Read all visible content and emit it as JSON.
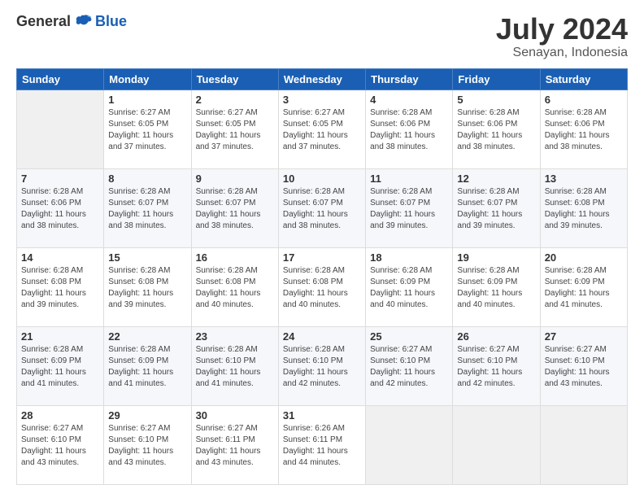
{
  "logo": {
    "general": "General",
    "blue": "Blue"
  },
  "title": {
    "month": "July 2024",
    "location": "Senayan, Indonesia"
  },
  "headers": [
    "Sunday",
    "Monday",
    "Tuesday",
    "Wednesday",
    "Thursday",
    "Friday",
    "Saturday"
  ],
  "weeks": [
    {
      "days": [
        {
          "num": "",
          "info": ""
        },
        {
          "num": "1",
          "info": "Sunrise: 6:27 AM\nSunset: 6:05 PM\nDaylight: 11 hours\nand 37 minutes."
        },
        {
          "num": "2",
          "info": "Sunrise: 6:27 AM\nSunset: 6:05 PM\nDaylight: 11 hours\nand 37 minutes."
        },
        {
          "num": "3",
          "info": "Sunrise: 6:27 AM\nSunset: 6:05 PM\nDaylight: 11 hours\nand 37 minutes."
        },
        {
          "num": "4",
          "info": "Sunrise: 6:28 AM\nSunset: 6:06 PM\nDaylight: 11 hours\nand 38 minutes."
        },
        {
          "num": "5",
          "info": "Sunrise: 6:28 AM\nSunset: 6:06 PM\nDaylight: 11 hours\nand 38 minutes."
        },
        {
          "num": "6",
          "info": "Sunrise: 6:28 AM\nSunset: 6:06 PM\nDaylight: 11 hours\nand 38 minutes."
        }
      ]
    },
    {
      "days": [
        {
          "num": "7",
          "info": "Sunrise: 6:28 AM\nSunset: 6:06 PM\nDaylight: 11 hours\nand 38 minutes."
        },
        {
          "num": "8",
          "info": "Sunrise: 6:28 AM\nSunset: 6:07 PM\nDaylight: 11 hours\nand 38 minutes."
        },
        {
          "num": "9",
          "info": "Sunrise: 6:28 AM\nSunset: 6:07 PM\nDaylight: 11 hours\nand 38 minutes."
        },
        {
          "num": "10",
          "info": "Sunrise: 6:28 AM\nSunset: 6:07 PM\nDaylight: 11 hours\nand 38 minutes."
        },
        {
          "num": "11",
          "info": "Sunrise: 6:28 AM\nSunset: 6:07 PM\nDaylight: 11 hours\nand 39 minutes."
        },
        {
          "num": "12",
          "info": "Sunrise: 6:28 AM\nSunset: 6:07 PM\nDaylight: 11 hours\nand 39 minutes."
        },
        {
          "num": "13",
          "info": "Sunrise: 6:28 AM\nSunset: 6:08 PM\nDaylight: 11 hours\nand 39 minutes."
        }
      ]
    },
    {
      "days": [
        {
          "num": "14",
          "info": "Sunrise: 6:28 AM\nSunset: 6:08 PM\nDaylight: 11 hours\nand 39 minutes."
        },
        {
          "num": "15",
          "info": "Sunrise: 6:28 AM\nSunset: 6:08 PM\nDaylight: 11 hours\nand 39 minutes."
        },
        {
          "num": "16",
          "info": "Sunrise: 6:28 AM\nSunset: 6:08 PM\nDaylight: 11 hours\nand 40 minutes."
        },
        {
          "num": "17",
          "info": "Sunrise: 6:28 AM\nSunset: 6:08 PM\nDaylight: 11 hours\nand 40 minutes."
        },
        {
          "num": "18",
          "info": "Sunrise: 6:28 AM\nSunset: 6:09 PM\nDaylight: 11 hours\nand 40 minutes."
        },
        {
          "num": "19",
          "info": "Sunrise: 6:28 AM\nSunset: 6:09 PM\nDaylight: 11 hours\nand 40 minutes."
        },
        {
          "num": "20",
          "info": "Sunrise: 6:28 AM\nSunset: 6:09 PM\nDaylight: 11 hours\nand 41 minutes."
        }
      ]
    },
    {
      "days": [
        {
          "num": "21",
          "info": "Sunrise: 6:28 AM\nSunset: 6:09 PM\nDaylight: 11 hours\nand 41 minutes."
        },
        {
          "num": "22",
          "info": "Sunrise: 6:28 AM\nSunset: 6:09 PM\nDaylight: 11 hours\nand 41 minutes."
        },
        {
          "num": "23",
          "info": "Sunrise: 6:28 AM\nSunset: 6:10 PM\nDaylight: 11 hours\nand 41 minutes."
        },
        {
          "num": "24",
          "info": "Sunrise: 6:28 AM\nSunset: 6:10 PM\nDaylight: 11 hours\nand 42 minutes."
        },
        {
          "num": "25",
          "info": "Sunrise: 6:27 AM\nSunset: 6:10 PM\nDaylight: 11 hours\nand 42 minutes."
        },
        {
          "num": "26",
          "info": "Sunrise: 6:27 AM\nSunset: 6:10 PM\nDaylight: 11 hours\nand 42 minutes."
        },
        {
          "num": "27",
          "info": "Sunrise: 6:27 AM\nSunset: 6:10 PM\nDaylight: 11 hours\nand 43 minutes."
        }
      ]
    },
    {
      "days": [
        {
          "num": "28",
          "info": "Sunrise: 6:27 AM\nSunset: 6:10 PM\nDaylight: 11 hours\nand 43 minutes."
        },
        {
          "num": "29",
          "info": "Sunrise: 6:27 AM\nSunset: 6:10 PM\nDaylight: 11 hours\nand 43 minutes."
        },
        {
          "num": "30",
          "info": "Sunrise: 6:27 AM\nSunset: 6:11 PM\nDaylight: 11 hours\nand 43 minutes."
        },
        {
          "num": "31",
          "info": "Sunrise: 6:26 AM\nSunset: 6:11 PM\nDaylight: 11 hours\nand 44 minutes."
        },
        {
          "num": "",
          "info": ""
        },
        {
          "num": "",
          "info": ""
        },
        {
          "num": "",
          "info": ""
        }
      ]
    }
  ]
}
